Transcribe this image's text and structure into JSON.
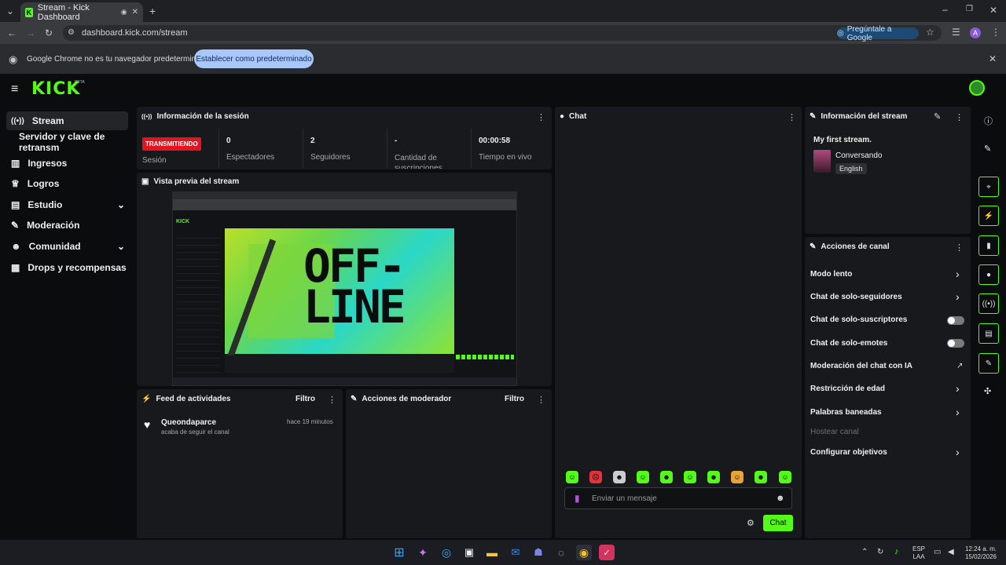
{
  "browser": {
    "tab_title": "Stream - Kick Dashboard",
    "url": "dashboard.kick.com/stream",
    "ask_google": "Pregúntale a Google",
    "profile_initial": "A",
    "infobar_text": "Google Chrome no es tu navegador predeterminado",
    "infobar_button": "Establecer como predeterminado"
  },
  "app": {
    "logo": "KICK",
    "logo_badge": "BETA",
    "brand_color": "#53fc18",
    "nav": [
      {
        "label": "Stream",
        "icon": "broadcast-icon"
      },
      {
        "label": "Servidor y clave de retransm",
        "icon": ""
      },
      {
        "label": "Ingresos",
        "icon": "chart-icon"
      },
      {
        "label": "Logros",
        "icon": "trophy-icon"
      },
      {
        "label": "Estudio",
        "icon": "studio-icon"
      },
      {
        "label": "Moderación",
        "icon": "wrench-icon"
      },
      {
        "label": "Comunidad",
        "icon": "people-icon"
      },
      {
        "label": "Drops y recompensas",
        "icon": "gift-icon"
      }
    ]
  },
  "session": {
    "title": "Información de la sesión",
    "status_badge": "TRANSMITIENDO",
    "status_label": "Sesión",
    "stats": [
      {
        "value": "0",
        "label": "Espectadores"
      },
      {
        "value": "2",
        "label": "Seguidores"
      },
      {
        "value": "-",
        "label": "Cantidad de suscripciones"
      },
      {
        "value": "00:00:58",
        "label": "Tiempo en vivo"
      }
    ]
  },
  "preview": {
    "title": "Vista previa del stream",
    "offline_text": "OFF- LINE"
  },
  "feed": {
    "title": "Feed de actividades",
    "filter": "Filtro",
    "items": [
      {
        "user": "Queondaparce",
        "text": "acaba de seguir el canal",
        "time": "hace 19 minutos"
      }
    ]
  },
  "mod_actions": {
    "title": "Acciones de moderador",
    "filter": "Filtro"
  },
  "chat": {
    "title": "Chat",
    "placeholder": "Enviar un mensaje",
    "send": "Chat"
  },
  "stream_info": {
    "title": "Información del stream",
    "stream_title": "My first stream.",
    "category": "Conversando",
    "language": "English"
  },
  "channel_actions": {
    "title": "Acciones de canal",
    "items": [
      {
        "label": "Modo lento",
        "control": "chevron"
      },
      {
        "label": "Chat de solo-seguidores",
        "control": "chevron"
      },
      {
        "label": "Chat de solo-suscriptores",
        "control": "toggle",
        "on": false
      },
      {
        "label": "Chat de solo-emotes",
        "control": "toggle",
        "on": false
      },
      {
        "label": "Moderación del chat con IA",
        "control": "external"
      },
      {
        "label": "Restricción de edad",
        "control": "chevron"
      },
      {
        "label": "Palabras baneadas",
        "control": "chevron"
      },
      {
        "label": "Hostear canal",
        "control": "none",
        "disabled": true
      },
      {
        "label": "Configurar objetivos",
        "control": "chevron"
      }
    ]
  },
  "taskbar": {
    "lang_top": "ESP",
    "lang_bottom": "LAA",
    "time": "12:24 a. m.",
    "date": "15/02/2026"
  }
}
